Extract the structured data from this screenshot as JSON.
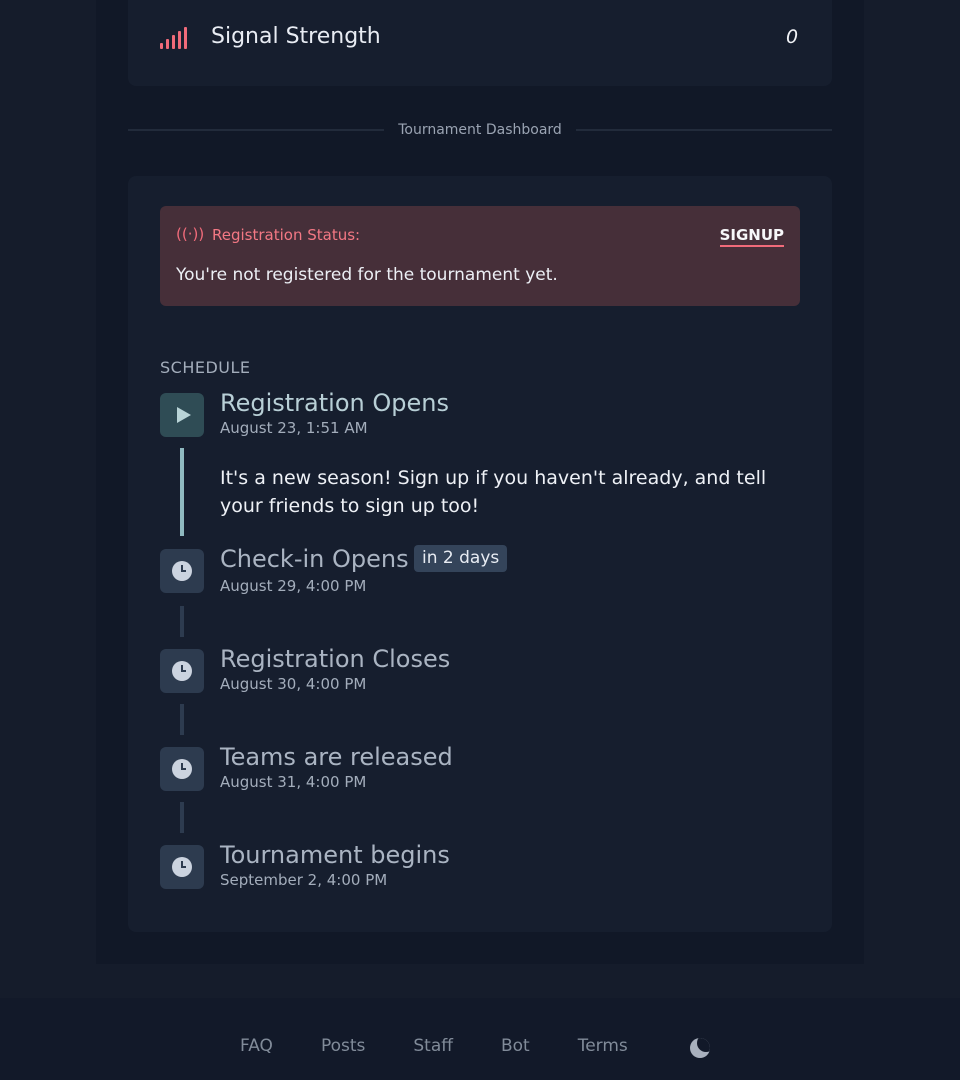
{
  "signal": {
    "title": "Signal Strength",
    "value": "0",
    "icon": "signal-bars-icon"
  },
  "divider": {
    "label": "Tournament Dashboard"
  },
  "registration": {
    "icon": "broadcast-icon",
    "label": "Registration Status:",
    "action": "SIGNUP",
    "message": "You're not registered for the tournament yet."
  },
  "schedule": {
    "heading": "SCHEDULE",
    "events": [
      {
        "title": "Registration Opens",
        "time": "August 23, 1:51 AM",
        "icon": "play-icon",
        "description": "It's a new season! Sign up if you haven't already, and tell your friends to sign up too!"
      },
      {
        "title": "Check-in Opens",
        "time": "August 29, 4:00 PM",
        "icon": "clock-icon",
        "badge": "in 2 days"
      },
      {
        "title": "Registration Closes",
        "time": "August 30, 4:00 PM",
        "icon": "clock-icon"
      },
      {
        "title": "Teams are released",
        "time": "August 31, 4:00 PM",
        "icon": "clock-icon"
      },
      {
        "title": "Tournament begins",
        "time": "September 2, 4:00 PM",
        "icon": "clock-icon"
      }
    ]
  },
  "footer": {
    "links": [
      "FAQ",
      "Posts",
      "Staff",
      "Bot",
      "Terms"
    ],
    "theme_toggle_icon": "moon-icon"
  },
  "colors": {
    "background": "#151c2b",
    "card": "#161e2e",
    "accent": "#f06b7a",
    "alert_background": "#462f39",
    "timeline_active": "#8fb9c0"
  }
}
